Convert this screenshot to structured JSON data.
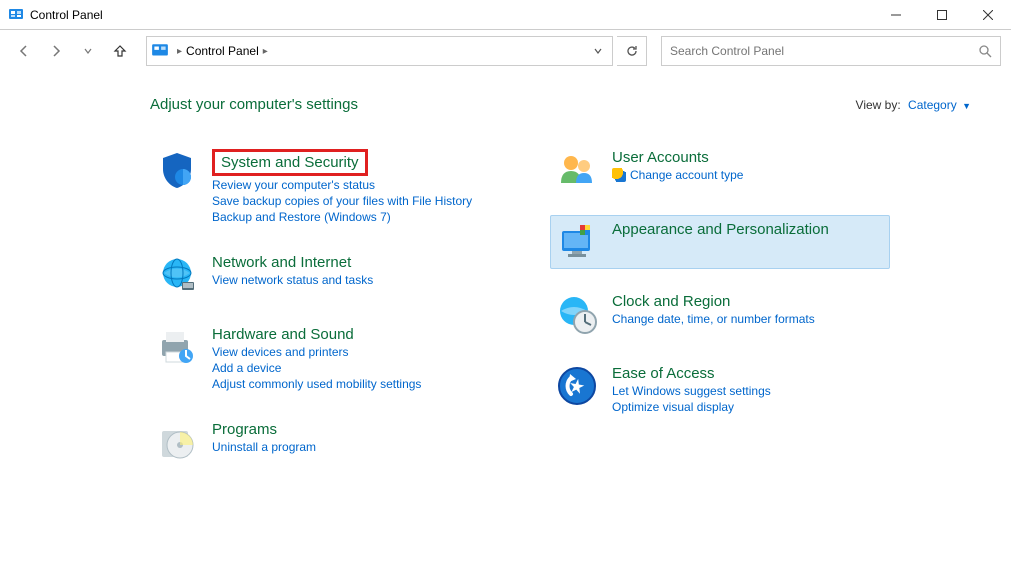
{
  "window": {
    "title": "Control Panel"
  },
  "breadcrumb": {
    "root": "Control Panel"
  },
  "search": {
    "placeholder": "Search Control Panel"
  },
  "heading": "Adjust your computer's settings",
  "viewby": {
    "label": "View by:",
    "value": "Category"
  },
  "categories": {
    "system_security": {
      "title": "System and Security",
      "links": [
        "Review your computer's status",
        "Save backup copies of your files with File History",
        "Backup and Restore (Windows 7)"
      ]
    },
    "network": {
      "title": "Network and Internet",
      "links": [
        "View network status and tasks"
      ]
    },
    "hardware": {
      "title": "Hardware and Sound",
      "links": [
        "View devices and printers",
        "Add a device",
        "Adjust commonly used mobility settings"
      ]
    },
    "programs": {
      "title": "Programs",
      "links": [
        "Uninstall a program"
      ]
    },
    "users": {
      "title": "User Accounts",
      "links": [
        "Change account type"
      ]
    },
    "appearance": {
      "title": "Appearance and Personalization",
      "links": []
    },
    "clock": {
      "title": "Clock and Region",
      "links": [
        "Change date, time, or number formats"
      ]
    },
    "ease": {
      "title": "Ease of Access",
      "links": [
        "Let Windows suggest settings",
        "Optimize visual display"
      ]
    }
  }
}
